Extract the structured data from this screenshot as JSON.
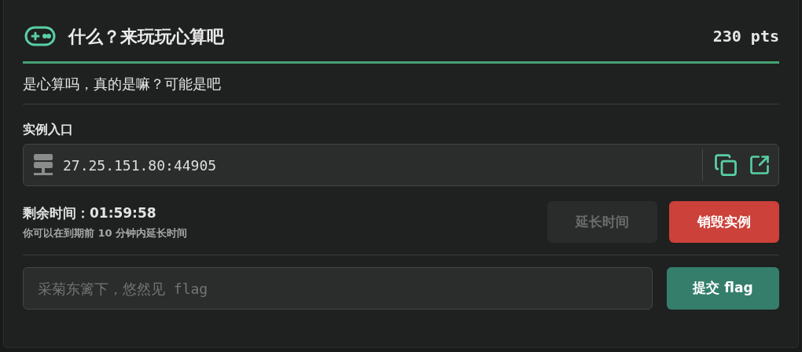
{
  "challenge": {
    "title": "什么？来玩玩心算吧",
    "points": "230 pts",
    "description": "是心算吗，真的是嘛？可能是吧"
  },
  "instance": {
    "label": "实例入口",
    "address": "27.25.151.80:44905"
  },
  "timer": {
    "remaining": "剩余时间：01:59:58",
    "hint": "你可以在到期前 10 分钟内延长时间"
  },
  "buttons": [
    {
      "label": "延长时间",
      "kind": "extend",
      "disabled": true
    },
    {
      "label": "销毁实例",
      "kind": "destroy",
      "disabled": false
    }
  ],
  "flag": {
    "placeholder": "采菊东篱下，悠然见 flag",
    "submit": "提交 flag"
  }
}
